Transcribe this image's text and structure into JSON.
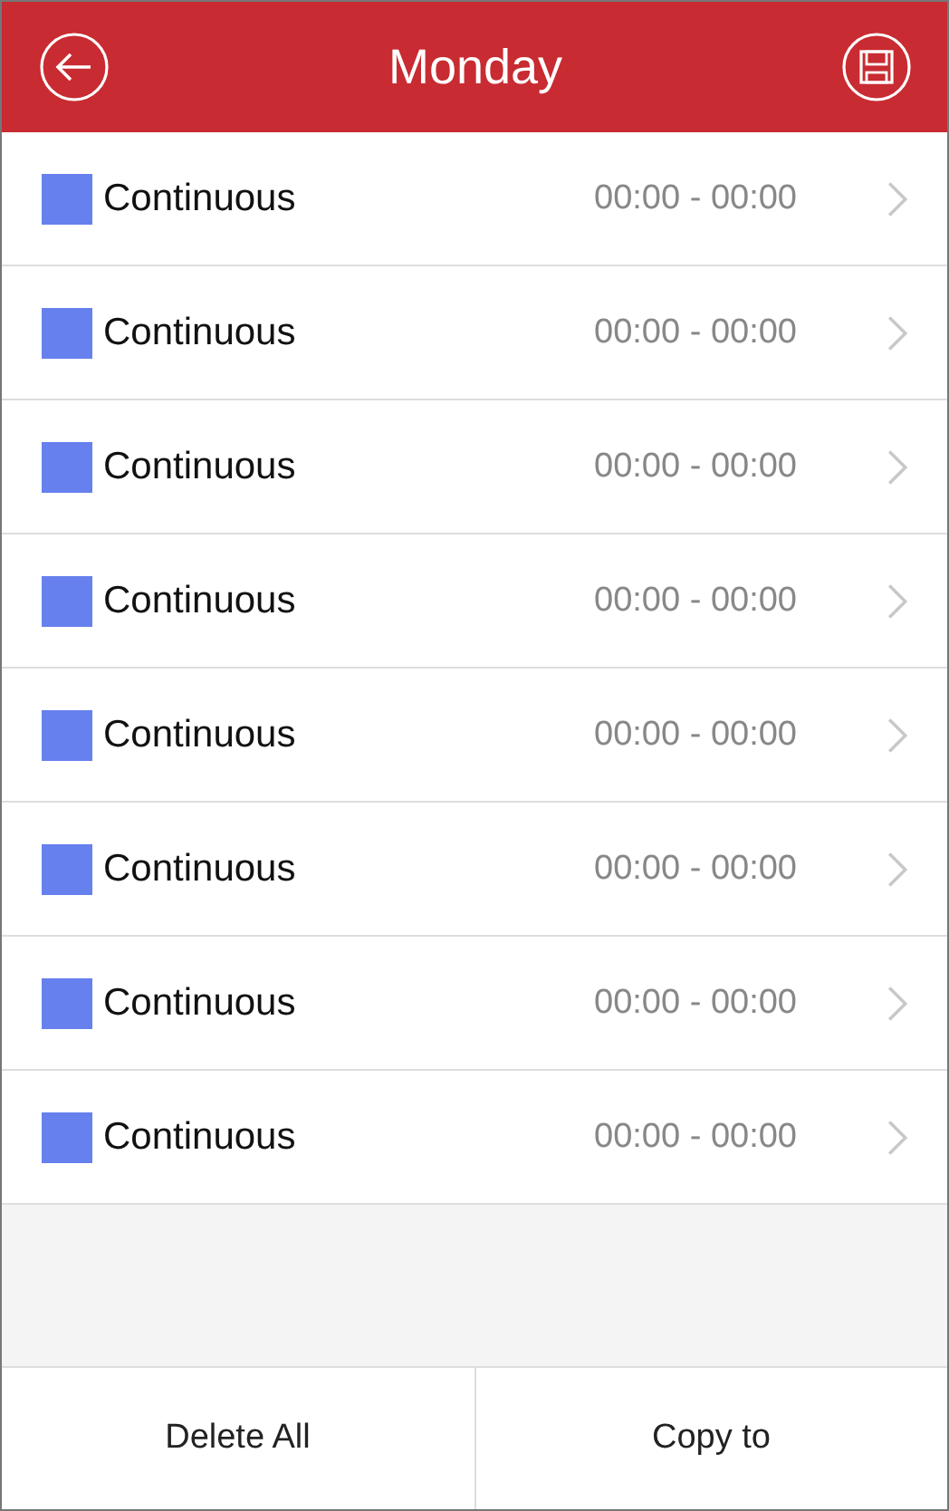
{
  "header": {
    "title": "Monday"
  },
  "periods": [
    {
      "label": "Continuous",
      "time": "00:00 - 00:00",
      "color": "#6680ee"
    },
    {
      "label": "Continuous",
      "time": "00:00 - 00:00",
      "color": "#6680ee"
    },
    {
      "label": "Continuous",
      "time": "00:00 - 00:00",
      "color": "#6680ee"
    },
    {
      "label": "Continuous",
      "time": "00:00 - 00:00",
      "color": "#6680ee"
    },
    {
      "label": "Continuous",
      "time": "00:00 - 00:00",
      "color": "#6680ee"
    },
    {
      "label": "Continuous",
      "time": "00:00 - 00:00",
      "color": "#6680ee"
    },
    {
      "label": "Continuous",
      "time": "00:00 - 00:00",
      "color": "#6680ee"
    },
    {
      "label": "Continuous",
      "time": "00:00 - 00:00",
      "color": "#6680ee"
    }
  ],
  "buttons": [
    "Delete All",
    "Copy to"
  ]
}
